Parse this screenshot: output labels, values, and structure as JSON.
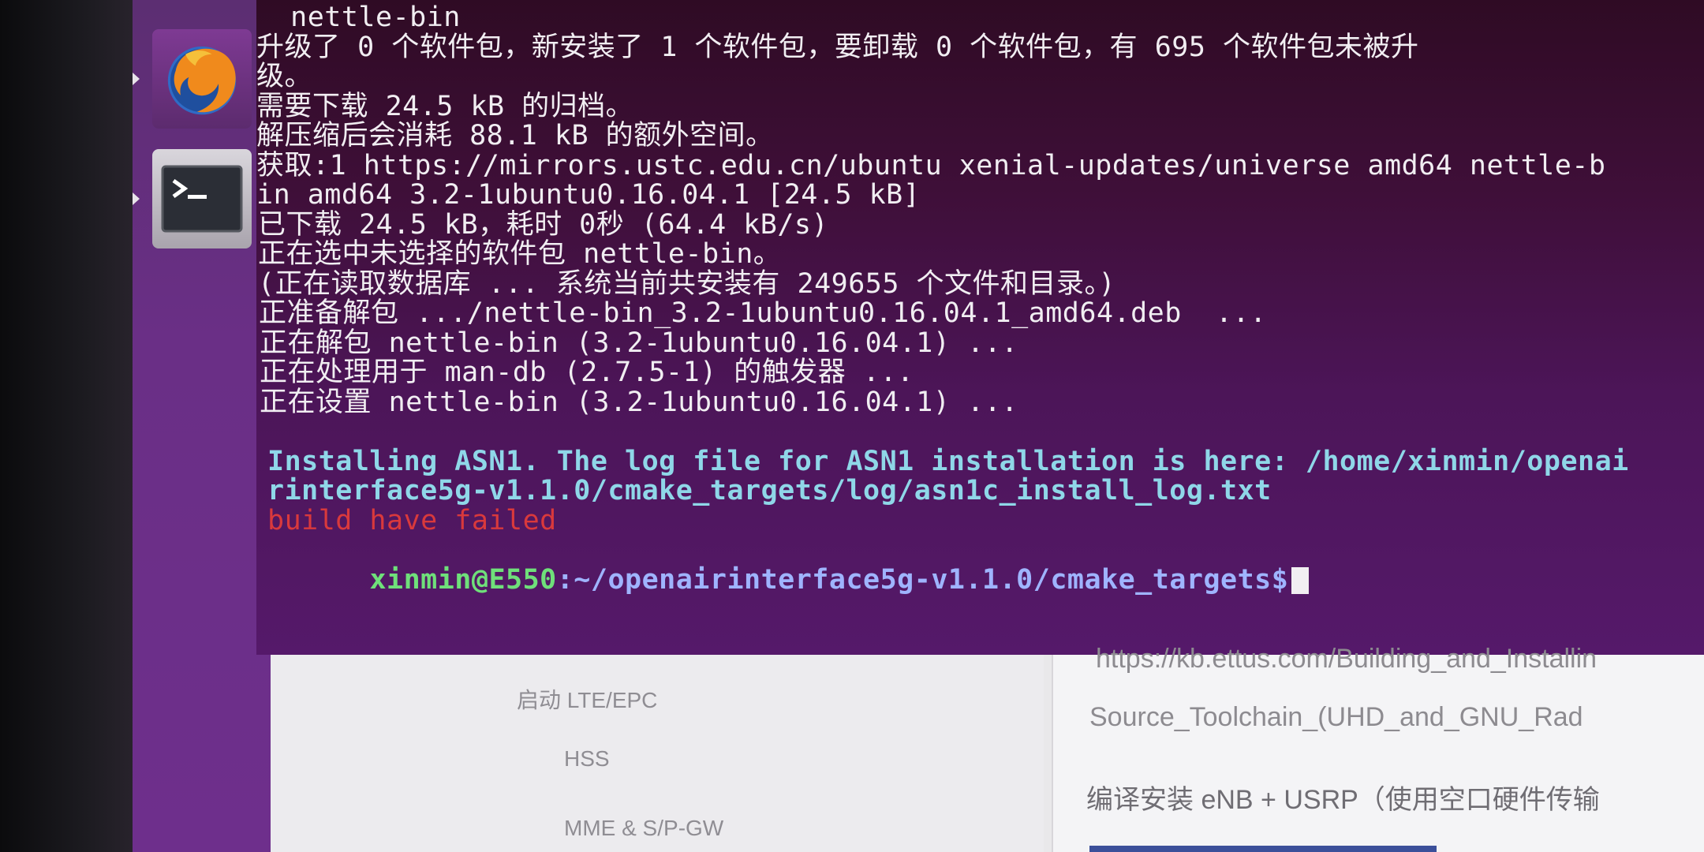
{
  "launcher": {
    "items": [
      {
        "name": "firefox",
        "icon": "firefox-icon"
      },
      {
        "name": "terminal",
        "icon": "terminal-icon"
      }
    ]
  },
  "terminal": {
    "lines": [
      "  nettle-bin",
      "升级了 0 个软件包，新安装了 1 个软件包，要卸载 0 个软件包，有 695 个软件包未被升",
      "级。",
      "需要下载 24.5 kB 的归档。",
      "解压缩后会消耗 88.1 kB 的额外空间。",
      "获取:1 https://mirrors.ustc.edu.cn/ubuntu xenial-updates/universe amd64 nettle-b",
      "in amd64 3.2-1ubuntu0.16.04.1 [24.5 kB]",
      "已下载 24.5 kB，耗时 0秒 (64.4 kB/s)",
      "正在选中未选择的软件包 nettle-bin。",
      "(正在读取数据库 ... 系统当前共安装有 249655 个文件和目录。)",
      "正准备解包 .../nettle-bin_3.2-1ubuntu0.16.04.1_amd64.deb  ...",
      "正在解包 nettle-bin (3.2-1ubuntu0.16.04.1) ...",
      "正在处理用于 man-db (2.7.5-1) 的触发器 ...",
      "正在设置 nettle-bin (3.2-1ubuntu0.16.04.1) ...",
      ""
    ],
    "asn1_line1": "Installing ASN1. The log file for ASN1 installation is here: /home/xinmin/openai",
    "asn1_line2": "rinterface5g-v1.1.0/cmake_targets/log/asn1c_install_log.txt",
    "error_line": "build have failed",
    "prompt_user": "xinmin@E550",
    "prompt_path": ":~/openairinterface5g-v1.1.0/cmake_targets$",
    "colors": {
      "background": "#3f0f39",
      "text": "#f1eef2",
      "info": "#8fd7e8",
      "error": "#d9393c",
      "prompt_user": "#6fe07a",
      "prompt_path": "#9fb4ff"
    }
  },
  "browser": {
    "nav": {
      "item1": "启动 LTE/EPC",
      "item2": "HSS",
      "item3": "MME & S/P-GW"
    },
    "doc": {
      "line1": "https://kb.ettus.com/Building_and_Installin",
      "line2": "Source_Toolchain_(UHD_and_GNU_Rad",
      "line3": "编译安装 eNB + USRP（使用空口硬件传输"
    }
  }
}
